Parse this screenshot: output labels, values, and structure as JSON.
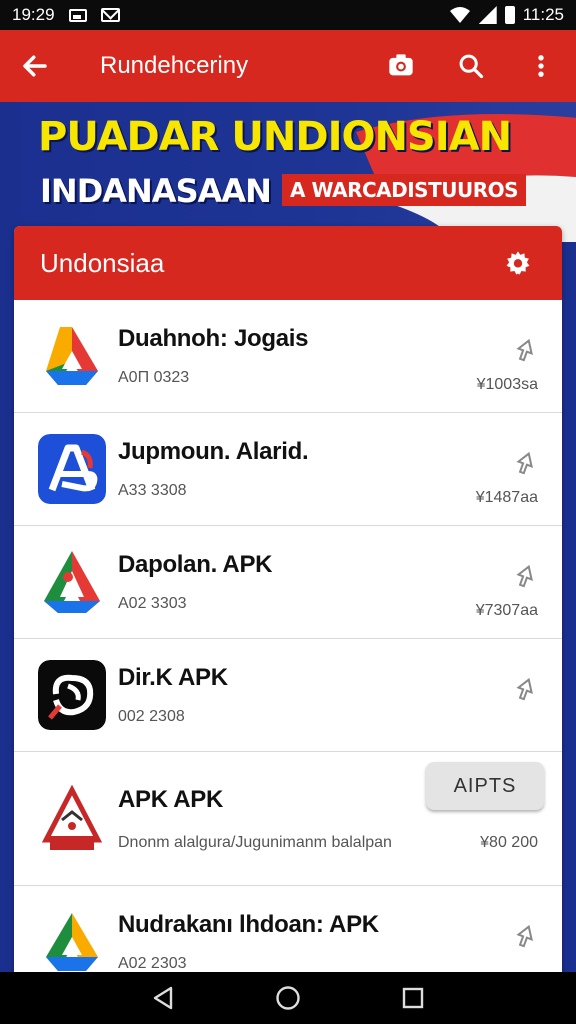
{
  "status_bar": {
    "time_left": "19:29",
    "time_right": "11:25"
  },
  "app_bar": {
    "title": "Rundehceriny"
  },
  "banner": {
    "title": "PUADAR UNDIONSIAN",
    "subtitle": "INDANASAAN",
    "tag": "A WARCADISTUUROS"
  },
  "card": {
    "title": "Undonsiaa",
    "apps": [
      {
        "name": "Duahnoh: Jogais",
        "code": "A0Π 0323",
        "size": "¥1003sa",
        "icon": "google-drive-icon"
      },
      {
        "name": "Jupmoun. Alarid.",
        "code": "A33 3308",
        "size": "¥1487aa",
        "icon": "blue-a-app-icon"
      },
      {
        "name": "Dapolan. APK",
        "code": "A02 3303",
        "size": "¥7307aa",
        "icon": "drive-variant-icon"
      },
      {
        "name": "Dir.K APK",
        "code": "002 2308",
        "size": "",
        "icon": "black-app-icon"
      },
      {
        "name": "APK APK",
        "desc": "Dnonm alalgura/Jugunimanm balalpan",
        "size": "¥80 200",
        "button": "AIPTS",
        "icon": "emblem-icon"
      },
      {
        "name": "Nudrakanı lhdoan: APK",
        "code": "A02 2303",
        "size": "",
        "icon": "google-drive-icon"
      }
    ]
  }
}
